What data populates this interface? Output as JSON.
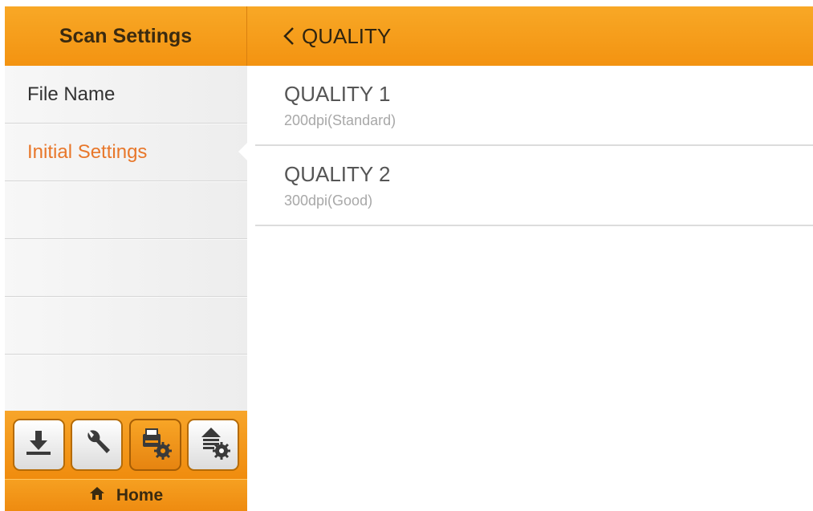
{
  "sidebar": {
    "title": "Scan Settings",
    "items": [
      {
        "label": "File Name"
      },
      {
        "label": "Initial Settings"
      }
    ],
    "toolbar": {
      "buttons": [
        {
          "icon": "download-icon"
        },
        {
          "icon": "wrench-icon"
        },
        {
          "icon": "scanner-settings-icon"
        },
        {
          "icon": "upload-settings-icon"
        }
      ]
    },
    "home_label": "Home"
  },
  "main": {
    "title": "QUALITY",
    "options": [
      {
        "title": "QUALITY 1",
        "subtitle": "200dpi(Standard)"
      },
      {
        "title": "QUALITY 2",
        "subtitle": "300dpi(Good)"
      }
    ]
  },
  "colors": {
    "accent": "#f39311",
    "active_text": "#e8772a"
  }
}
